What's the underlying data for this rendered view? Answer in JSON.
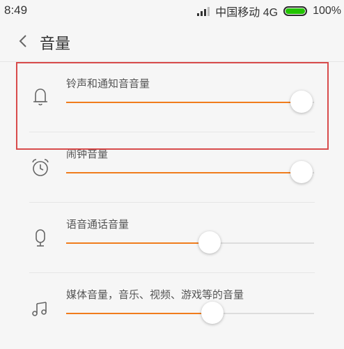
{
  "status_bar": {
    "time": "8:49",
    "carrier": "中国移动 4G",
    "battery_text": "100%",
    "battery_level": 1.0,
    "battery_color": "#22c400"
  },
  "header": {
    "back_icon": "chevron-left-icon",
    "title": "音量"
  },
  "accent_color": "#f07c1c",
  "highlight_color": "#d84b4b",
  "volume_items": [
    {
      "id": "ringtone",
      "icon": "bell-icon",
      "label": "铃声和通知音音量",
      "level": 0.95
    },
    {
      "id": "alarm",
      "icon": "alarm-clock-icon",
      "label": "闹钟音量",
      "level": 0.95
    },
    {
      "id": "call",
      "icon": "microphone-icon",
      "label": "语音通话音量",
      "level": 0.58
    },
    {
      "id": "media",
      "icon": "music-note-icon",
      "label": "媒体音量，音乐、视频、游戏等的音量",
      "level": 0.59
    }
  ]
}
